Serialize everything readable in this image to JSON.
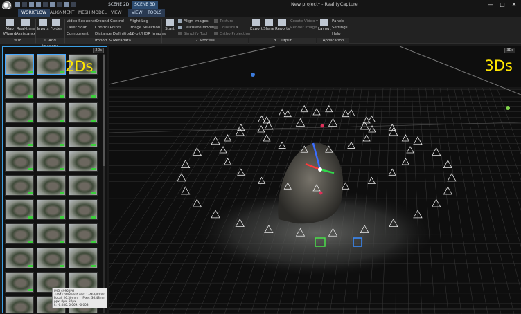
{
  "titlebar": {
    "scene_tabs": [
      "SCENE 2D",
      "SCENE 3D"
    ],
    "window_title": "New project* - RealityCapture",
    "controls": [
      "—",
      "□",
      "✕"
    ]
  },
  "tabs": [
    "WORKFLOW",
    "ALIGNMENT",
    "MESH MODEL",
    "VIEW",
    "VIEW",
    "TOOLS"
  ],
  "ribbon": {
    "wiz": {
      "map_wizard": "Map Wizard",
      "realtime": "Real-time Assistance",
      "label": "Wiz"
    },
    "add_imagery": {
      "inputs": "Inputs",
      "folder": "Folder",
      "label": "1. Add imagery"
    },
    "import_col1": [
      "Video Sequence",
      "Laser Scan",
      "Component"
    ],
    "import_col2": [
      "Ground Control",
      "Control Points",
      "Distance Definitions"
    ],
    "import_col3": [
      "Flight Log",
      "Image Selection",
      "16-bit/HDR Images"
    ],
    "import_label": "Import & Metadata",
    "process": {
      "start": "Start",
      "col1": [
        "Align Images",
        "Calculate Model ▾",
        "Simplify Tool"
      ],
      "col2": [
        "Texture",
        "Colorize ▾",
        "Ortho Projection"
      ],
      "label": "2. Process"
    },
    "output": {
      "export": "Export",
      "share": "Share",
      "reports": "Reports",
      "col": [
        "Create Video ▾",
        "Render Image"
      ],
      "label": "3. Output"
    },
    "application": {
      "layout": "Layout",
      "col": [
        "Panels",
        "Settings",
        "Help"
      ],
      "label": "Application"
    }
  },
  "panel2d": {
    "badge": "2Ds",
    "overlay_label": "2Ds",
    "tooltip": {
      "name": "IMG_4995.JPG",
      "size": "3264x2448",
      "focal": "Focal: 26.30mm",
      "features": "Features: 13464/40000",
      "pixel": "Pixel: 36.48mm",
      "ppx": "ppx: 0px, 32px",
      "k": "k: -0.080, 0.069, -0.003"
    }
  },
  "view3d": {
    "badge": "3Ds",
    "overlay_label": "3Ds"
  },
  "colors": {
    "accent": "#3ba0e6",
    "label_yellow": "#ffe600",
    "ok_green": "#3ccf3c"
  }
}
